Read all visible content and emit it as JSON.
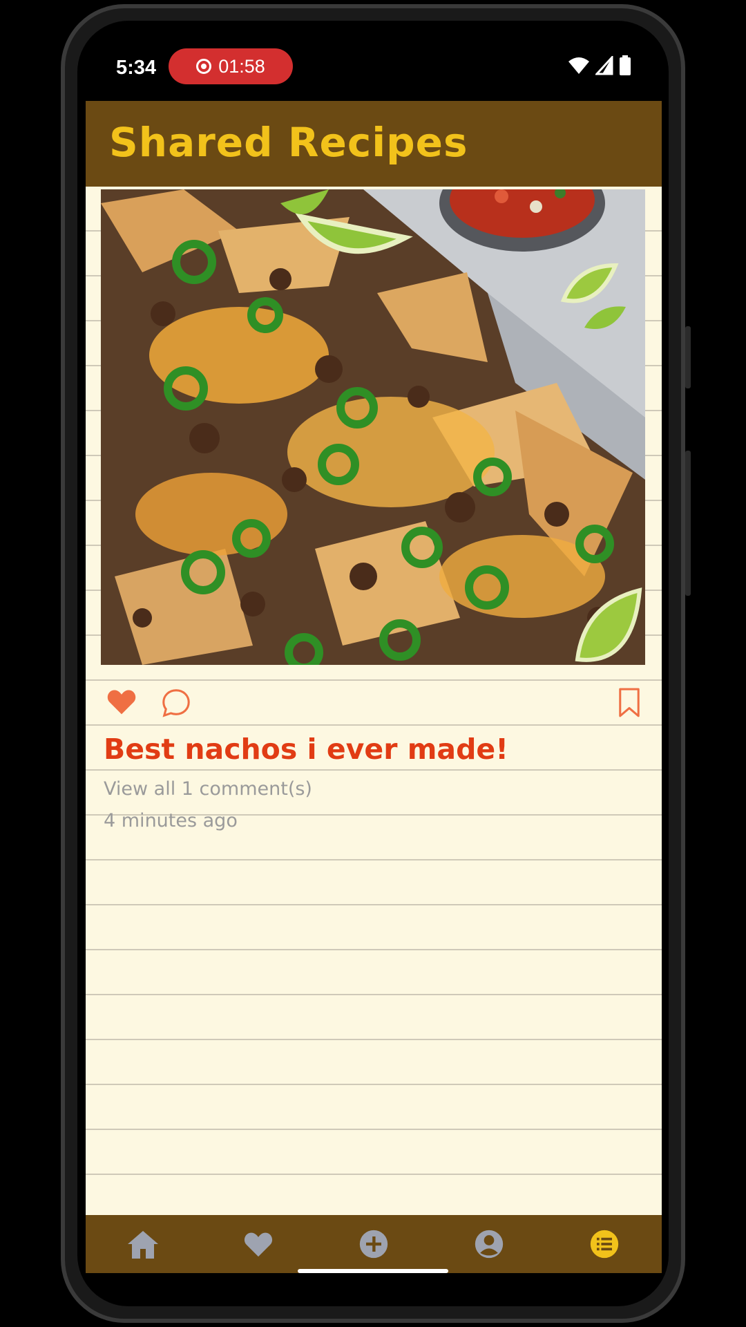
{
  "status_bar": {
    "time": "5:34",
    "recording_timer": "01:58"
  },
  "app": {
    "title": "Shared Recipes",
    "colors": {
      "header": "#6b4a13",
      "title": "#f2c21b",
      "accent": "#e13c14",
      "paper": "#fdf8e1"
    }
  },
  "post": {
    "image_label": "nachos-photo",
    "liked": true,
    "title": "Best nachos i ever made!",
    "comments_link": "View all 1 comment(s)",
    "timestamp": "4 minutes ago"
  },
  "bottom_nav": {
    "items": [
      {
        "icon": "home-icon",
        "active": false
      },
      {
        "icon": "heart-icon",
        "active": false
      },
      {
        "icon": "add-circle-icon",
        "active": false
      },
      {
        "icon": "profile-icon",
        "active": false
      },
      {
        "icon": "list-icon",
        "active": true
      }
    ]
  }
}
